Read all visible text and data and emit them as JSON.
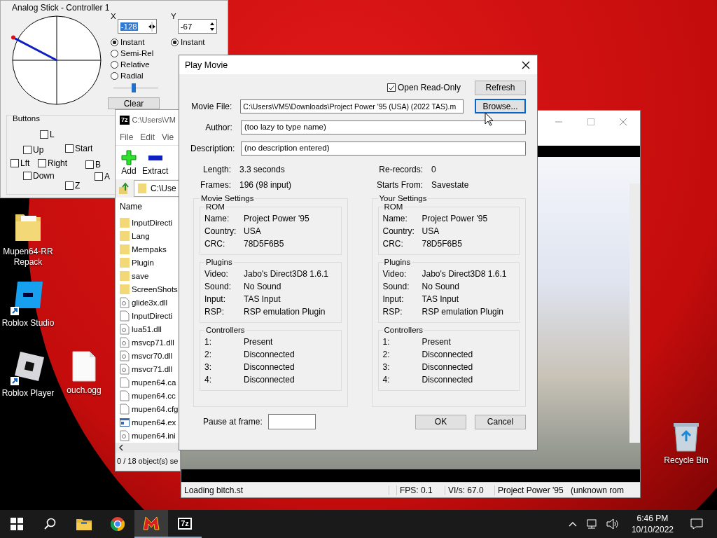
{
  "desktop": {
    "icons": [
      {
        "label": "Mupen64-RR Repack",
        "kind": "folder"
      },
      {
        "label": "Roblox Studio",
        "kind": "studio"
      },
      {
        "label": "Roblox Player",
        "kind": "player"
      },
      {
        "label": "ouch.ogg",
        "kind": "file"
      },
      {
        "label": "Recycle Bin",
        "kind": "bin"
      }
    ]
  },
  "analog_window": {
    "title": "Analog Stick - Controller 1",
    "x_axis": {
      "label": "X",
      "value": "-128",
      "modes": [
        {
          "label": "Instant",
          "selected": true
        },
        {
          "label": "Semi-Rel",
          "selected": false
        },
        {
          "label": "Relative",
          "selected": false
        },
        {
          "label": "Radial",
          "selected": false
        }
      ],
      "level": 0.45,
      "clear_button": "Clear"
    },
    "y_axis": {
      "label": "Y",
      "value": "-67",
      "modes": [
        {
          "label": "Instant",
          "selected": true
        }
      ]
    },
    "buttons": {
      "title": "Buttons",
      "items": [
        {
          "label": "L",
          "checked": false
        },
        {
          "label": "Up",
          "checked": false
        },
        {
          "label": "Start",
          "checked": false
        },
        {
          "label": "Lft",
          "checked": false
        },
        {
          "label": "Right",
          "checked": false
        },
        {
          "label": "B",
          "checked": false
        },
        {
          "label": "Down",
          "checked": false
        },
        {
          "label": "A",
          "checked": false
        },
        {
          "label": "Z",
          "checked": false
        }
      ]
    }
  },
  "archiver_window": {
    "logo_text": "7z",
    "title": "C:\\Users\\VM",
    "menu": [
      "File",
      "Edit",
      "Vie"
    ],
    "toolbar": [
      {
        "label": "Add",
        "kind": "add"
      },
      {
        "label": "Extract",
        "kind": "extract"
      }
    ],
    "path": "C:\\Use",
    "column": "Name",
    "files": [
      {
        "name": "InputDirecti",
        "kind": "folder"
      },
      {
        "name": "Lang",
        "kind": "folder"
      },
      {
        "name": "Mempaks",
        "kind": "folder"
      },
      {
        "name": "Plugin",
        "kind": "folder"
      },
      {
        "name": "save",
        "kind": "folder"
      },
      {
        "name": "ScreenShots",
        "kind": "folder"
      },
      {
        "name": "glide3x.dll",
        "kind": "dll"
      },
      {
        "name": "InputDirecti",
        "kind": "file"
      },
      {
        "name": "lua51.dll",
        "kind": "dll"
      },
      {
        "name": "msvcp71.dll",
        "kind": "dll"
      },
      {
        "name": "msvcr70.dll",
        "kind": "dll"
      },
      {
        "name": "msvcr71.dll",
        "kind": "dll"
      },
      {
        "name": "mupen64.ca",
        "kind": "file"
      },
      {
        "name": "mupen64.cc",
        "kind": "file"
      },
      {
        "name": "mupen64.cfg",
        "kind": "file"
      },
      {
        "name": "mupen64.ex",
        "kind": "exe"
      },
      {
        "name": "mupen64.ini",
        "kind": "dll"
      }
    ],
    "status": "0 / 18 object(s) se"
  },
  "emulator_window": {
    "status_bar": [
      "Loading bitch.st",
      "FPS: 0.1",
      "VI/s: 67.0",
      "Project Power '95",
      "(unknown rom"
    ]
  },
  "play_movie": {
    "title": "Play Movie",
    "open_read_only": {
      "label": "Open Read-Only",
      "checked": true
    },
    "refresh_button": "Refresh",
    "movie_file": {
      "label": "Movie File:",
      "value": "C:\\Users\\VM5\\Downloads\\Project Power '95 (USA) (2022 TAS).m"
    },
    "browse_button": "Browse...",
    "author": {
      "label": "Author:",
      "value": "(too lazy to type name)"
    },
    "description": {
      "label": "Description:",
      "value": "(no description entered)"
    },
    "info": [
      {
        "label": "Length:",
        "value": "3.3 seconds"
      },
      {
        "label": "Re-records:",
        "value": "0"
      },
      {
        "label": "Frames:",
        "value": "196  (98 input)"
      },
      {
        "label": "Starts From:",
        "value": "Savestate"
      }
    ],
    "settings": [
      {
        "title": "Movie Settings",
        "groups": [
          {
            "title": "ROM",
            "rows": [
              {
                "label": "Name:",
                "value": "Project Power '95"
              },
              {
                "label": "Country:",
                "value": "USA"
              },
              {
                "label": "CRC:",
                "value": "78D5F6B5"
              }
            ]
          },
          {
            "title": "Plugins",
            "rows": [
              {
                "label": "Video:",
                "value": "Jabo's Direct3D8 1.6.1"
              },
              {
                "label": "Sound:",
                "value": "No Sound"
              },
              {
                "label": "Input:",
                "value": "TAS Input"
              },
              {
                "label": "RSP:",
                "value": "RSP emulation Plugin"
              }
            ]
          },
          {
            "title": "Controllers",
            "rows": [
              {
                "label": "1:",
                "value": "Present"
              },
              {
                "label": "2:",
                "value": "Disconnected"
              },
              {
                "label": "3:",
                "value": "Disconnected"
              },
              {
                "label": "4:",
                "value": "Disconnected"
              }
            ]
          }
        ]
      },
      {
        "title": "Your Settings",
        "groups": [
          {
            "title": "ROM",
            "rows": [
              {
                "label": "Name:",
                "value": "Project Power '95"
              },
              {
                "label": "Country:",
                "value": "USA"
              },
              {
                "label": "CRC:",
                "value": "78D5F6B5"
              }
            ]
          },
          {
            "title": "Plugins",
            "rows": [
              {
                "label": "Video:",
                "value": "Jabo's Direct3D8 1.6.1"
              },
              {
                "label": "Sound:",
                "value": "No Sound"
              },
              {
                "label": "Input:",
                "value": "TAS Input"
              },
              {
                "label": "RSP:",
                "value": "RSP emulation Plugin"
              }
            ]
          },
          {
            "title": "Controllers",
            "rows": [
              {
                "label": "1:",
                "value": "Present"
              },
              {
                "label": "2:",
                "value": "Disconnected"
              },
              {
                "label": "3:",
                "value": "Disconnected"
              },
              {
                "label": "4:",
                "value": "Disconnected"
              }
            ]
          }
        ]
      }
    ],
    "pause_at_frame": {
      "label": "Pause at frame:"
    },
    "buttons": [
      "OK",
      "Cancel"
    ]
  },
  "taskbar": {
    "items": [
      {
        "kind": "start",
        "open": false,
        "active": false
      },
      {
        "kind": "search",
        "open": false,
        "active": false
      },
      {
        "kind": "explorer",
        "open": false,
        "active": false
      },
      {
        "kind": "browser",
        "open": false,
        "active": false
      },
      {
        "kind": "emulator",
        "open": true,
        "active": true
      },
      {
        "kind": "archiver",
        "open": true,
        "active": false,
        "logo_text": "7z"
      }
    ],
    "time": "6:46 PM",
    "date": "10/10/2022"
  }
}
